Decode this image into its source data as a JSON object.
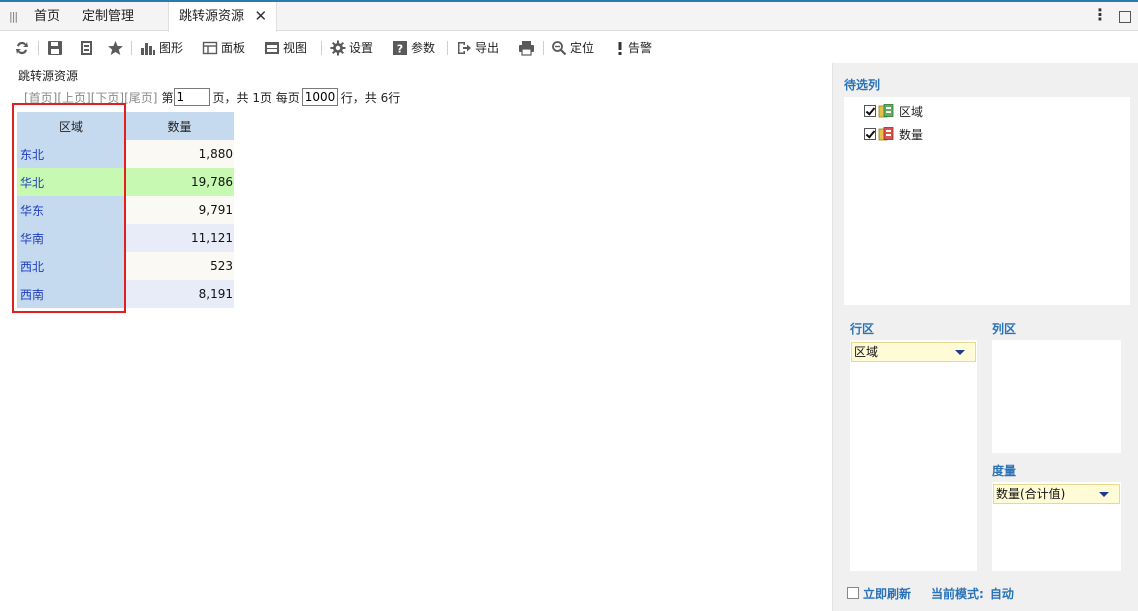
{
  "tabs": [
    {
      "label": "首页"
    },
    {
      "label": "定制管理"
    },
    {
      "label": "跳转源资源",
      "active": true
    }
  ],
  "toolbar": {
    "chart": "图形",
    "panel": "面板",
    "view": "视图",
    "settings": "设置",
    "params": "参数",
    "export": "导出",
    "locate": "定位",
    "alert": "告警"
  },
  "report": {
    "title": "跳转源资源",
    "pager": {
      "first": "[首页]",
      "prev": "[上页]",
      "next": "[下页]",
      "last": "[尾页]",
      "page_prefix": "第",
      "page_value": "1",
      "page_suffix": "页，共 1页 每页",
      "page_size": "1000",
      "rows_suffix": "行，共 6行"
    },
    "table": {
      "headers": [
        "区域",
        "数量"
      ],
      "rows": [
        {
          "region": "东北",
          "qty": "1,880"
        },
        {
          "region": "华北",
          "qty": "19,786",
          "highlight": true
        },
        {
          "region": "华东",
          "qty": "9,791"
        },
        {
          "region": "华南",
          "qty": "11,121"
        },
        {
          "region": "西北",
          "qty": "523"
        },
        {
          "region": "西南",
          "qty": "8,191"
        }
      ]
    }
  },
  "side_panel": {
    "candidates_title": "待选列",
    "fields": [
      {
        "label": "区域",
        "checked": true,
        "icon": "dimension-icon"
      },
      {
        "label": "数量",
        "checked": true,
        "icon": "measure-icon"
      }
    ],
    "row_area_title": "行区",
    "row_items": [
      "区域"
    ],
    "col_area_title": "列区",
    "measure_title": "度量",
    "measure_items": [
      "数量(合计值)"
    ],
    "refresh_label": "立即刷新",
    "mode_label": "当前模式:",
    "mode_value": "自动"
  },
  "colors": {
    "accent": "#2a72b8",
    "header_bg": "#c5d9ef",
    "highlight_row": "#c7f9b3",
    "annotation_box": "#e21e1e"
  }
}
